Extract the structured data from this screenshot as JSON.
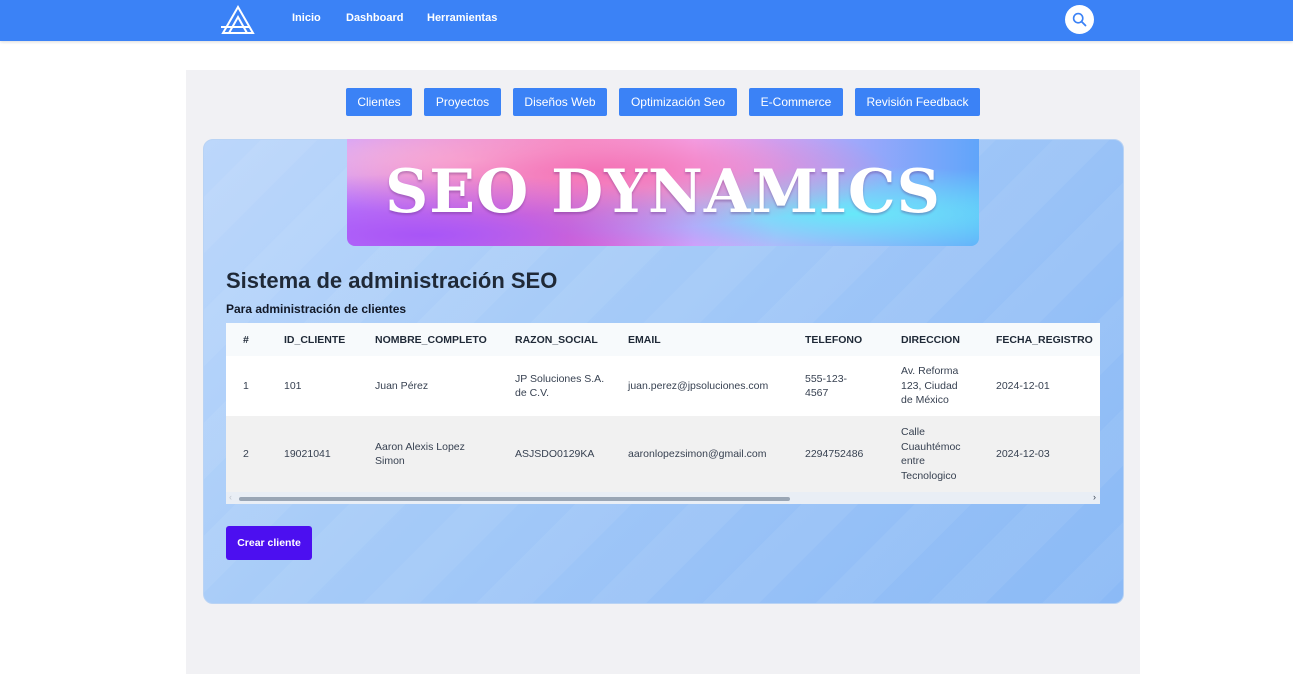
{
  "nav": {
    "links": [
      "Inicio",
      "Dashboard",
      "Herramientas"
    ]
  },
  "tabs": [
    "Clientes",
    "Proyectos",
    "Diseños Web",
    "Optimización Seo",
    "E-Commerce",
    "Revisión Feedback"
  ],
  "banner": {
    "text": "SEO DYNAMICS"
  },
  "page": {
    "title": "Sistema de administración SEO",
    "subtitle": "Para administración de clientes"
  },
  "table": {
    "headers": [
      "#",
      "ID_CLIENTE",
      "NOMBRE_COMPLETO",
      "RAZON_SOCIAL",
      "EMAIL",
      "TELEFONO",
      "DIRECCION",
      "FECHA_REGISTRO"
    ],
    "rows": [
      [
        "1",
        "101",
        "Juan Pérez",
        "JP Soluciones S.A. de C.V.",
        "juan.perez@jpsoluciones.com",
        "555-123-4567",
        "Av. Reforma 123, Ciudad de México",
        "2024-12-01"
      ],
      [
        "2",
        "19021041",
        "Aaron Alexis Lopez Simon",
        "ASJSDO0129KA",
        "aaronlopezsimon@gmail.com",
        "2294752486",
        "Calle Cuauhtémoc entre Tecnologico",
        "2024-12-03"
      ]
    ]
  },
  "actions": {
    "create_label": "Crear cliente"
  },
  "colors": {
    "primary": "#3b82f6",
    "create": "#4c0ff0"
  }
}
